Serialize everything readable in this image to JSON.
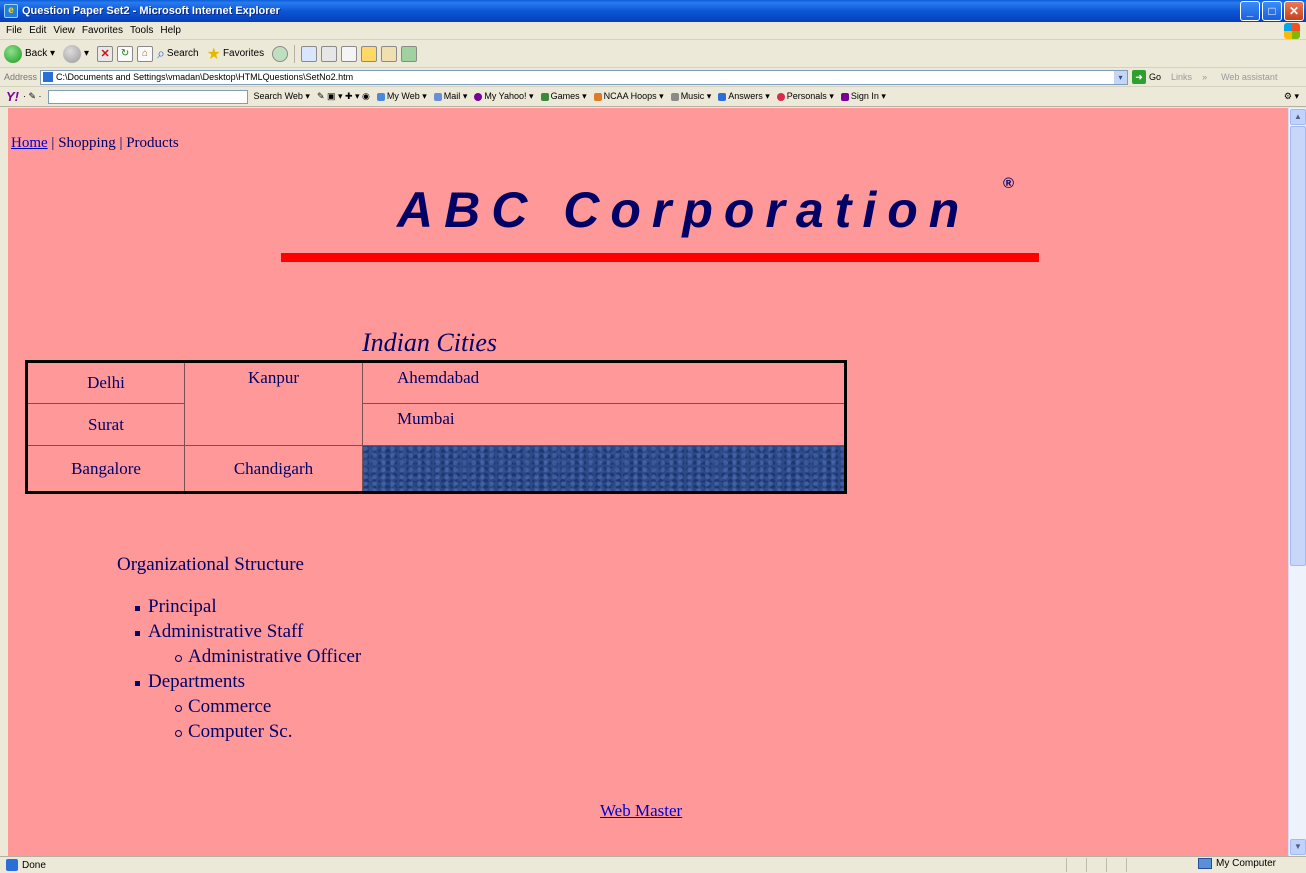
{
  "window": {
    "title": "Question Paper Set2 - Microsoft Internet Explorer",
    "buttons": [
      "minimize",
      "maximize",
      "close"
    ]
  },
  "menu": [
    "File",
    "Edit",
    "View",
    "Favorites",
    "Tools",
    "Help"
  ],
  "toolbar": {
    "back_label": "Back",
    "search_label": "Search",
    "favorites_label": "Favorites"
  },
  "address": {
    "label": "Address",
    "value": "C:\\Documents and Settings\\vmadan\\Desktop\\HTMLQuestions\\SetNo2.htm",
    "go_label": "Go",
    "links_label": "Links",
    "web_assistant_label": "Web assistant"
  },
  "yahoo_toolbar": {
    "logo": "Y!",
    "items": [
      "Search Web",
      "My Web",
      "Mail",
      "My Yahoo!",
      "Games",
      "NCAA Hoops",
      "Music",
      "Answers",
      "Personals",
      "Sign In"
    ]
  },
  "page": {
    "nav": {
      "home": "Home",
      "sep1": " | ",
      "shopping": "Shopping",
      "sep2": " | ",
      "products": "Products"
    },
    "corp_title": "ABC Corporation",
    "registered_mark": "®",
    "table_caption": "Indian Cities",
    "cities": {
      "delhi": "Delhi",
      "kanpur": "Kanpur",
      "ahemdabad": "Ahemdabad",
      "surat": "Surat",
      "mumbai": "Mumbai",
      "bangalore": "Bangalore",
      "chandigarh": "Chandigarh"
    },
    "org_title": "Organizational Structure",
    "org": {
      "principal": "Principal",
      "admin_staff": "Administrative Staff",
      "admin_officer": "Administrative Officer",
      "departments": "Departments",
      "commerce": "Commerce",
      "computer_sc": "Computer Sc."
    },
    "webmaster": "Web Master"
  },
  "status": {
    "text": "Done",
    "zone": "My Computer"
  },
  "colors": {
    "page_background": "#ff9999",
    "title_text": "#000066",
    "rule": "#ff0000",
    "link": "#0000cc"
  }
}
